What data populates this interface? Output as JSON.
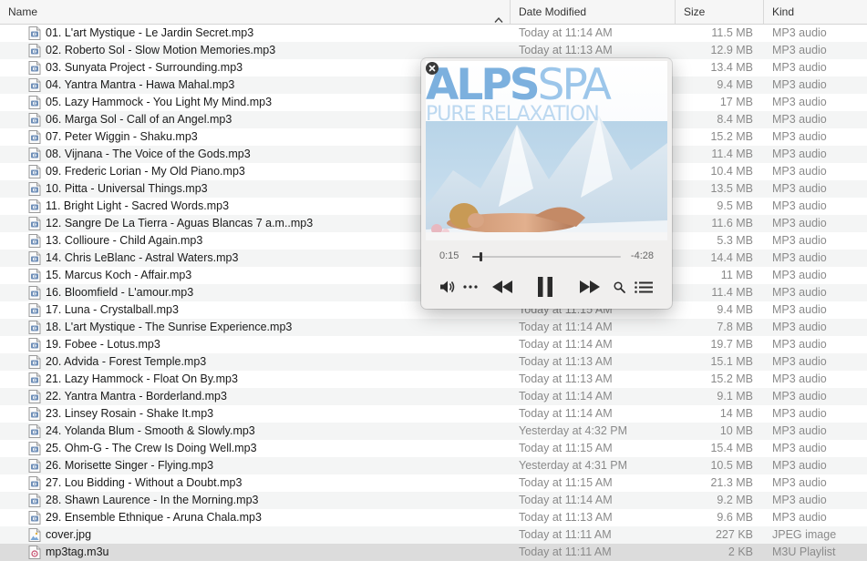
{
  "columns": {
    "name": "Name",
    "date": "Date Modified",
    "size": "Size",
    "kind": "Kind"
  },
  "files": [
    {
      "name": "01. L'art Mystique - Le Jardin Secret.mp3",
      "date": "Today at 11:14 AM",
      "size": "11.5 MB",
      "kind": "MP3 audio"
    },
    {
      "name": "02. Roberto Sol - Slow Motion Memories.mp3",
      "date": "Today at 11:13 AM",
      "size": "12.9 MB",
      "kind": "MP3 audio"
    },
    {
      "name": "03. Sunyata Project - Surrounding.mp3",
      "date": "Today at 11:15 AM",
      "size": "13.4 MB",
      "kind": "MP3 audio"
    },
    {
      "name": "04. Yantra Mantra - Hawa Mahal.mp3",
      "date": "Today at 11:14 AM",
      "size": "9.4 MB",
      "kind": "MP3 audio"
    },
    {
      "name": "05. Lazy Hammock - You Light My Mind.mp3",
      "date": "Today at 11:13 AM",
      "size": "17 MB",
      "kind": "MP3 audio"
    },
    {
      "name": "06. Marga Sol - Call of an Angel.mp3",
      "date": "Today at 11:14 AM",
      "size": "8.4 MB",
      "kind": "MP3 audio"
    },
    {
      "name": "07. Peter Wiggin - Shaku.mp3",
      "date": "Today at 11:15 AM",
      "size": "15.2 MB",
      "kind": "MP3 audio"
    },
    {
      "name": "08. Vijnana - The Voice of the Gods.mp3",
      "date": "Today at 11:14 AM",
      "size": "11.4 MB",
      "kind": "MP3 audio"
    },
    {
      "name": "09. Frederic Lorian - My Old Piano.mp3",
      "date": "Today at 11:14 AM",
      "size": "10.4 MB",
      "kind": "MP3 audio"
    },
    {
      "name": "10. Pitta - Universal Things.mp3",
      "date": "Today at 11:15 AM",
      "size": "13.5 MB",
      "kind": "MP3 audio"
    },
    {
      "name": "11. Bright Light - Sacred Words.mp3",
      "date": "Today at 11:14 AM",
      "size": "9.5 MB",
      "kind": "MP3 audio"
    },
    {
      "name": "12. Sangre De La Tierra - Aguas Blancas 7 a.m..mp3",
      "date": "Today at 11:14 AM",
      "size": "11.6 MB",
      "kind": "MP3 audio"
    },
    {
      "name": "13. Collioure - Child Again.mp3",
      "date": "Today at 11:15 AM",
      "size": "5.3 MB",
      "kind": "MP3 audio"
    },
    {
      "name": "14. Chris LeBlanc - Astral Waters.mp3",
      "date": "Today at 11:14 AM",
      "size": "14.4 MB",
      "kind": "MP3 audio"
    },
    {
      "name": "15. Marcus Koch - Affair.mp3",
      "date": "Today at 11:13 AM",
      "size": "11 MB",
      "kind": "MP3 audio"
    },
    {
      "name": "16. Bloomfield - L'amour.mp3",
      "date": "Today at 11:14 AM",
      "size": "11.4 MB",
      "kind": "MP3 audio"
    },
    {
      "name": "17. Luna - Crystalball.mp3",
      "date": "Today at 11:15 AM",
      "size": "9.4 MB",
      "kind": "MP3 audio"
    },
    {
      "name": "18. L'art Mystique - The Sunrise Experience.mp3",
      "date": "Today at 11:14 AM",
      "size": "7.8 MB",
      "kind": "MP3 audio"
    },
    {
      "name": "19. Fobee - Lotus.mp3",
      "date": "Today at 11:14 AM",
      "size": "19.7 MB",
      "kind": "MP3 audio"
    },
    {
      "name": "20. Advida - Forest Temple.mp3",
      "date": "Today at 11:13 AM",
      "size": "15.1 MB",
      "kind": "MP3 audio"
    },
    {
      "name": "21. Lazy Hammock - Float On By.mp3",
      "date": "Today at 11:13 AM",
      "size": "15.2 MB",
      "kind": "MP3 audio"
    },
    {
      "name": "22. Yantra Mantra - Borderland.mp3",
      "date": "Today at 11:14 AM",
      "size": "9.1 MB",
      "kind": "MP3 audio"
    },
    {
      "name": "23. Linsey Rosain - Shake It.mp3",
      "date": "Today at 11:14 AM",
      "size": "14 MB",
      "kind": "MP3 audio"
    },
    {
      "name": "24. Yolanda Blum - Smooth & Slowly.mp3",
      "date": "Yesterday at 4:32 PM",
      "size": "10 MB",
      "kind": "MP3 audio"
    },
    {
      "name": "25. Ohm-G - The Crew Is Doing Well.mp3",
      "date": "Today at 11:15 AM",
      "size": "15.4 MB",
      "kind": "MP3 audio"
    },
    {
      "name": "26. Morisette Singer - Flying.mp3",
      "date": "Yesterday at 4:31 PM",
      "size": "10.5 MB",
      "kind": "MP3 audio"
    },
    {
      "name": "27. Lou Bidding - Without a Doubt.mp3",
      "date": "Today at 11:15 AM",
      "size": "21.3 MB",
      "kind": "MP3 audio"
    },
    {
      "name": "28. Shawn Laurence - In the Morning.mp3",
      "date": "Today at 11:14 AM",
      "size": "9.2 MB",
      "kind": "MP3 audio"
    },
    {
      "name": "29. Ensemble Ethnique - Aruna Chala.mp3",
      "date": "Today at 11:13 AM",
      "size": "9.6 MB",
      "kind": "MP3 audio"
    },
    {
      "name": "cover.jpg",
      "date": "Today at 11:11 AM",
      "size": "227 KB",
      "kind": "JPEG image"
    },
    {
      "name": "mp3tag.m3u",
      "date": "Today at 11:11 AM",
      "size": "2 KB",
      "kind": "M3U Playlist",
      "selected": true
    }
  ],
  "player": {
    "art_title_bold": "ALPS",
    "art_title_light": "SPA",
    "art_subtitle": "PURE RELAXATION",
    "elapsed": "0:15",
    "remaining": "-4:28",
    "progress_fraction": 0.055,
    "state": "playing",
    "icons": [
      "close-icon",
      "volume-icon",
      "more-icon",
      "rewind-icon",
      "pause-icon",
      "fast-forward-icon",
      "search-icon",
      "playlist-icon"
    ]
  }
}
